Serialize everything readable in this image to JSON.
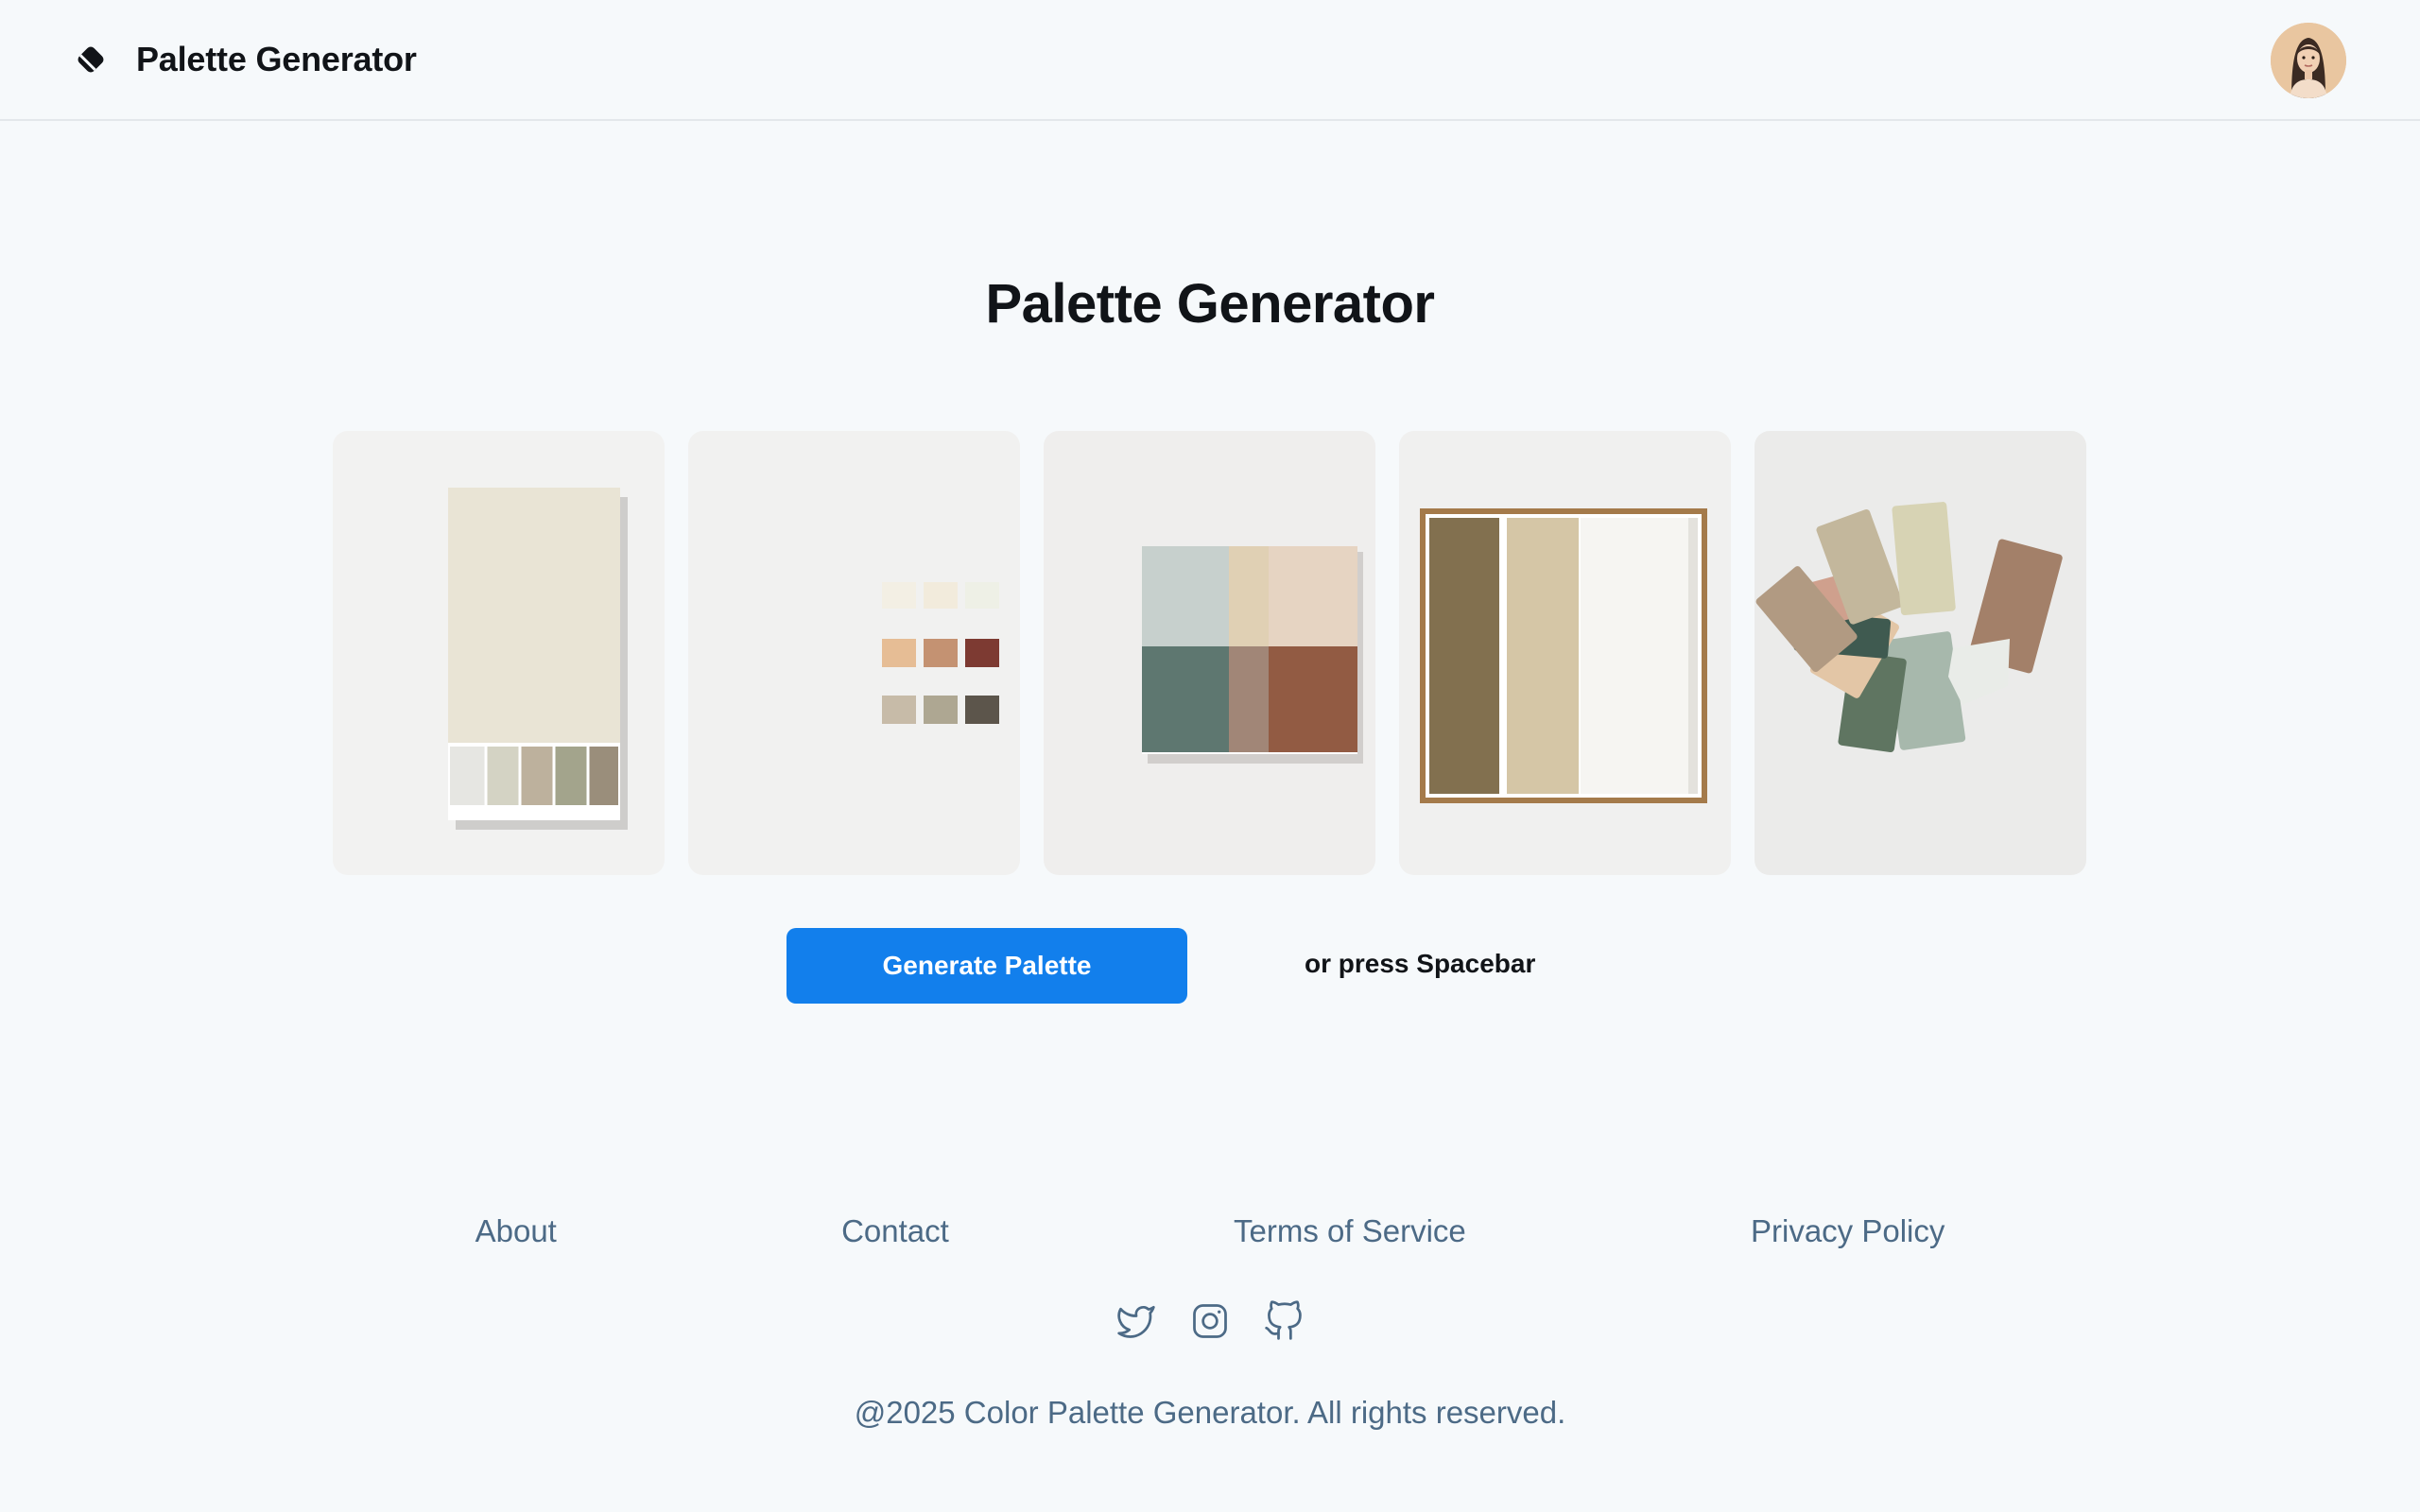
{
  "header": {
    "brand": "Palette Generator",
    "logo_icon": "diamond-logo-icon",
    "avatar_icon": "user-avatar"
  },
  "main": {
    "title": "Palette Generator",
    "cards": [
      {
        "name": "tall-swatch-card",
        "colors": [
          "#e9e4d5",
          "#e6e6e2",
          "#d4d3c4",
          "#bdb19d",
          "#a3a48c",
          "#9a8e7b"
        ]
      },
      {
        "name": "small-swatches-card",
        "colors": [
          "#f3efe4",
          "#f2ebdc",
          "#eef0e6",
          "#e6bd95",
          "#c49272",
          "#7d3a32",
          "#c7bba8",
          "#aea792",
          "#5c554b"
        ]
      },
      {
        "name": "block-palette-card",
        "colors": [
          "#c7d0cd",
          "#e0d0b4",
          "#e6d4c2",
          "#5e7770",
          "#a18677",
          "#925b43"
        ]
      },
      {
        "name": "framed-stripes-card",
        "colors": [
          "#82704f",
          "#d5c6a6",
          "#f6f5f2",
          "#a47a4a"
        ]
      },
      {
        "name": "fan-deck-card",
        "colors": [
          "#a38069",
          "#d7d3b4",
          "#c3b79c",
          "#b19a82",
          "#cfa08d",
          "#b6c1bd",
          "#3f5a50",
          "#e3c6a6",
          "#5f7561",
          "#a7b8ac",
          "#e9ece8"
        ]
      }
    ],
    "generate_label": "Generate Palette",
    "hint": "or press Spacebar"
  },
  "footer": {
    "links": [
      "About",
      "Contact",
      "Terms of Service",
      "Privacy Policy"
    ],
    "socials": [
      "twitter-icon",
      "instagram-icon",
      "github-icon"
    ],
    "copyright": "@2025 Color Palette Generator. All rights reserved."
  },
  "colors": {
    "accent": "#127fec",
    "link": "#4c6a86",
    "background": "#f6f9fb"
  }
}
